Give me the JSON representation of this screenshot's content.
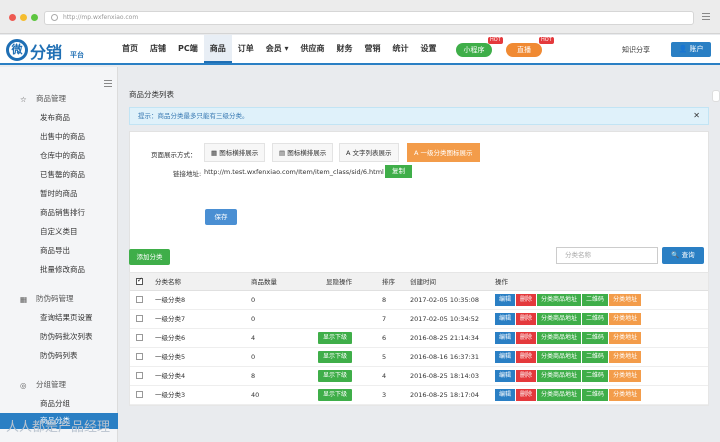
{
  "browser": {
    "url": "http://mp.wxfenxiao.com"
  },
  "colors": {
    "accent": "#2a7fc4",
    "green": "#3fae49",
    "red": "#e4393c",
    "orange": "#f39c4a"
  },
  "logo": {
    "char": "微",
    "text": "分销",
    "sub": "平台"
  },
  "nav": {
    "items": [
      "首页",
      "店铺",
      "PC端",
      "商品",
      "订单",
      "会员 ▾",
      "供应商",
      "财务",
      "营销",
      "统计",
      "设置"
    ],
    "active_index": 3,
    "miniapp": "小程序",
    "live": "直播",
    "hot": "HOT",
    "user": "知识分享",
    "account": "账户"
  },
  "sidebar": {
    "groups": [
      {
        "title": "商品管理",
        "icon": "shopping-icon"
      },
      {
        "title": "防伪码管理",
        "icon": "qrcode-icon"
      },
      {
        "title": "分组管理",
        "icon": "folder-icon"
      }
    ],
    "items": [
      "发布商品",
      "出售中的商品",
      "仓库中的商品",
      "已售罄的商品",
      "暂时的商品",
      "商品销售排行",
      "自定义类目",
      "商品导出",
      "批量修改商品",
      "查询结果页设置",
      "防伪码批次列表",
      "防伪码列表",
      "商品分组",
      "商品分类"
    ]
  },
  "page": {
    "title": "商品分类列表",
    "notice_prefix": "提示：",
    "notice": "商品分类最多只能有三级分类。",
    "display_label": "页面展示方式：",
    "modes": [
      "图标横排展示",
      "图标横排展示",
      "文字列表展示",
      "一级分类图标展示"
    ],
    "link_label": "链接地址:",
    "link_value": "http://m.test.wxfenxiao.com/Item/item_class/sid/6.html",
    "copy": "复制",
    "save": "保存",
    "add": "添加分类",
    "search_placeholder": "分类名称",
    "search": "查询"
  },
  "table": {
    "headers": [
      "分类名称",
      "商品数量",
      "显隐操作",
      "排序",
      "创建时间",
      "操作"
    ],
    "ops": [
      "编辑",
      "删除",
      "分类商品地址",
      "二维码",
      "分类地址"
    ],
    "rows": [
      {
        "name": "一级分类8",
        "count": "0",
        "toggle": "",
        "sort": "8",
        "time": "2017-02-05 10:35:08"
      },
      {
        "name": "一级分类7",
        "count": "0",
        "toggle": "",
        "sort": "7",
        "time": "2017-02-05 10:34:52"
      },
      {
        "name": "一级分类6",
        "count": "4",
        "toggle": "显示下级",
        "sort": "6",
        "time": "2016-08-25 21:14:34"
      },
      {
        "name": "一级分类5",
        "count": "0",
        "toggle": "显示下级",
        "sort": "5",
        "time": "2016-08-16 16:37:31"
      },
      {
        "name": "一级分类4",
        "count": "8",
        "toggle": "显示下级",
        "sort": "4",
        "time": "2016-08-25 18:14:03"
      },
      {
        "name": "一级分类3",
        "count": "40",
        "toggle": "显示下级",
        "sort": "3",
        "time": "2016-08-25 18:17:04"
      }
    ]
  },
  "watermark": "人人都是产品经理"
}
